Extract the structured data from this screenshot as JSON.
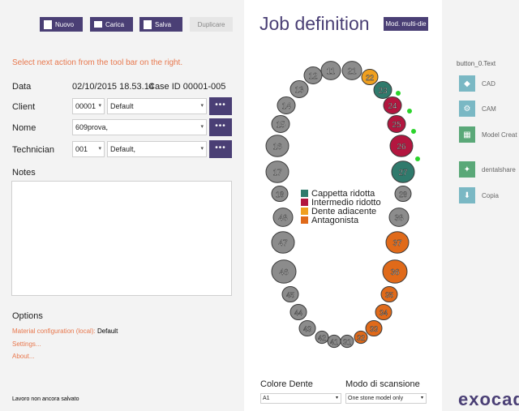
{
  "toolbar": {
    "nuovo": "Nuovo",
    "carica": "Carica",
    "salva": "Salva",
    "duplicare": "Duplicare"
  },
  "hint": "Select next action from the tool bar on the right.",
  "form": {
    "data_label": "Data",
    "data_value": "02/10/2015 18.53.14",
    "case_id": "Case ID 00001-005",
    "client_label": "Client",
    "client_code": "00001",
    "client_name": "Default",
    "nome_label": "Nome",
    "nome_value": "609prova,",
    "tech_label": "Technician",
    "tech_code": "001",
    "tech_name": "Default,",
    "dots": "•••",
    "notes_label": "Notes"
  },
  "options": {
    "title": "Options",
    "material_label": "Material configuration (local):",
    "material_value": "Default",
    "settings": "Settings...",
    "about": "About..."
  },
  "status": "Lavoro non ancora salvato",
  "main": {
    "title": "Job definition",
    "mod_button": "Mod. multi-die",
    "legend": [
      {
        "label": "Cappetta ridotta",
        "color": "#2f7a6c"
      },
      {
        "label": "Intermedio ridotto",
        "color": "#b3163f"
      },
      {
        "label": "Dente adiacente",
        "color": "#f0a020"
      },
      {
        "label": "Antagonista",
        "color": "#e06a1a"
      }
    ],
    "colore_label": "Colore Dente",
    "colore_value": "A1",
    "modo_label": "Modo di scansione",
    "modo_value": "One stone model only"
  },
  "teeth": [
    {
      "n": "11",
      "type": "grey"
    },
    {
      "n": "12",
      "type": "grey"
    },
    {
      "n": "13",
      "type": "grey"
    },
    {
      "n": "14",
      "type": "grey"
    },
    {
      "n": "15",
      "type": "grey"
    },
    {
      "n": "16",
      "type": "grey"
    },
    {
      "n": "17",
      "type": "grey"
    },
    {
      "n": "18",
      "type": "grey"
    },
    {
      "n": "21",
      "type": "grey"
    },
    {
      "n": "22",
      "type": "adjacent"
    },
    {
      "n": "23",
      "type": "cap"
    },
    {
      "n": "24",
      "type": "inter"
    },
    {
      "n": "25",
      "type": "inter"
    },
    {
      "n": "26",
      "type": "inter"
    },
    {
      "n": "27",
      "type": "cap"
    },
    {
      "n": "28",
      "type": "grey"
    },
    {
      "n": "31",
      "type": "grey"
    },
    {
      "n": "32",
      "type": "ant"
    },
    {
      "n": "33",
      "type": "ant"
    },
    {
      "n": "34",
      "type": "ant"
    },
    {
      "n": "35",
      "type": "ant"
    },
    {
      "n": "36",
      "type": "ant"
    },
    {
      "n": "37",
      "type": "ant"
    },
    {
      "n": "38",
      "type": "grey"
    },
    {
      "n": "41",
      "type": "grey"
    },
    {
      "n": "42",
      "type": "grey"
    },
    {
      "n": "43",
      "type": "grey"
    },
    {
      "n": "44",
      "type": "grey"
    },
    {
      "n": "45",
      "type": "grey"
    },
    {
      "n": "46",
      "type": "grey"
    },
    {
      "n": "47",
      "type": "grey"
    },
    {
      "n": "48",
      "type": "grey"
    }
  ],
  "tooth_colors": {
    "grey": "#8c8c8c",
    "cap": "#2f7a6c",
    "inter": "#b3163f",
    "adjacent": "#f0a020",
    "ant": "#e06a1a"
  },
  "right": {
    "header": "button_0.Text",
    "items": [
      "CAD",
      "CAM",
      "Model Creat",
      "dentalshare",
      "Copia"
    ]
  },
  "brand": "exocad"
}
